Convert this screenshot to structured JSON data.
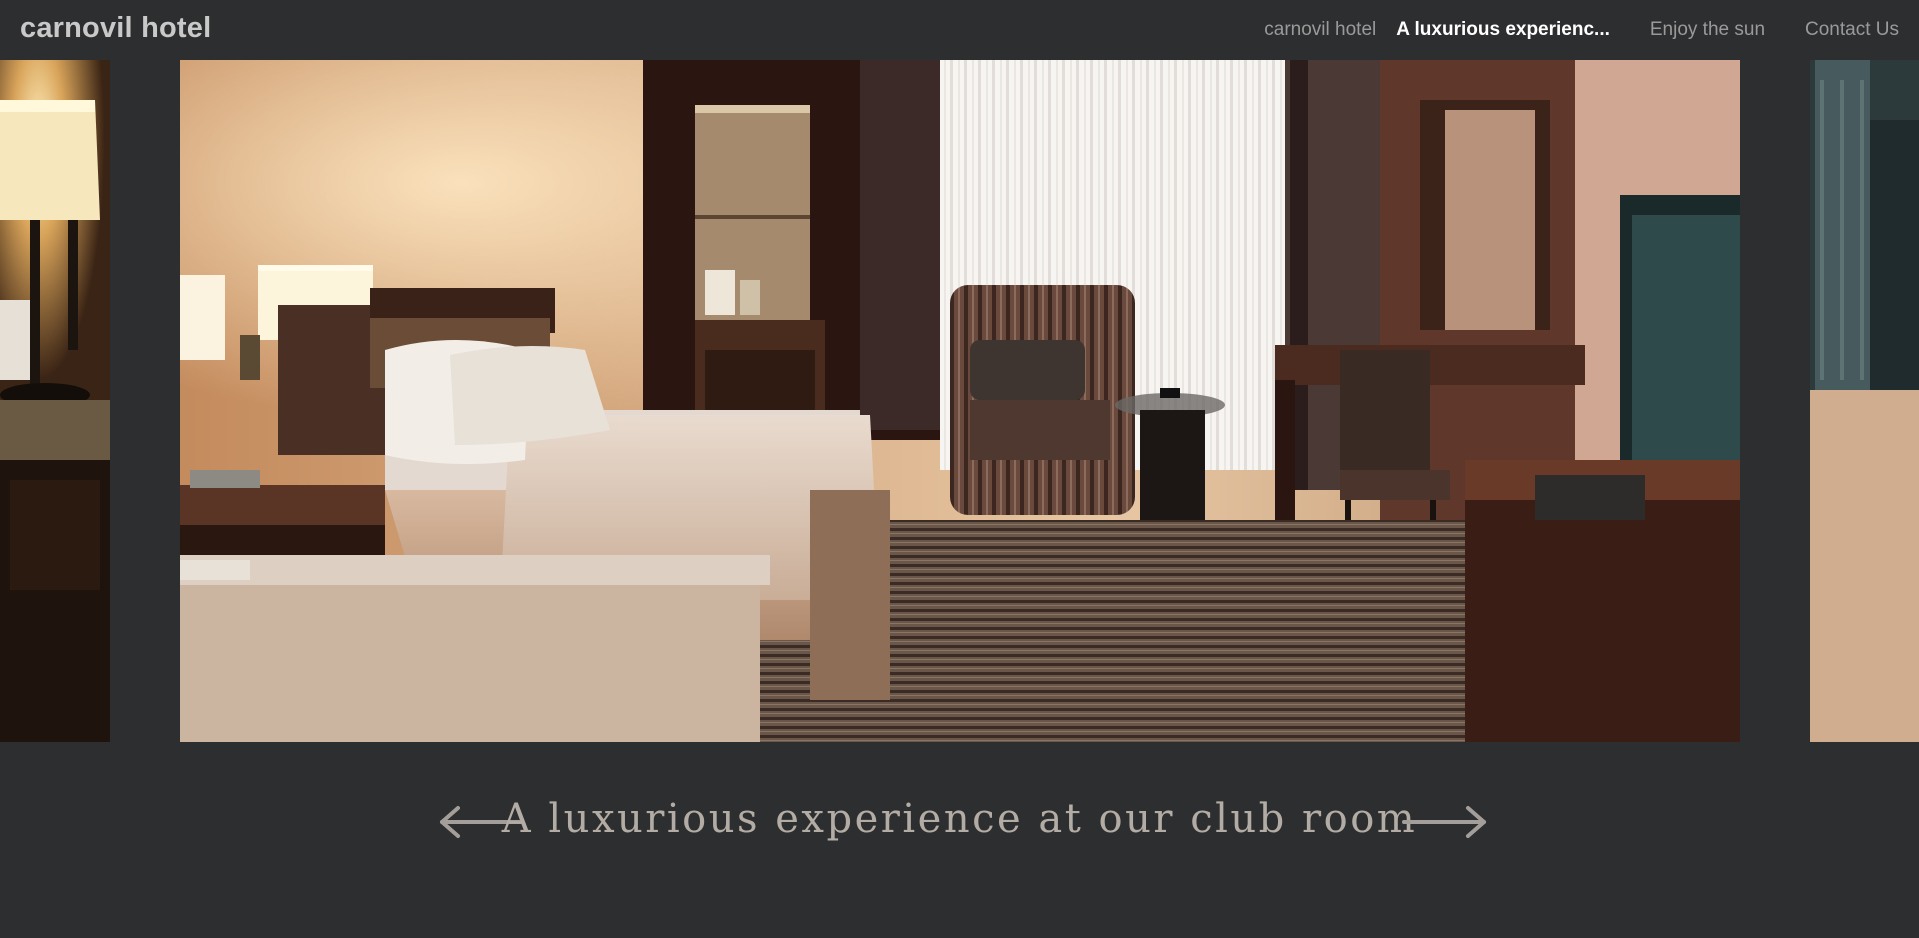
{
  "header": {
    "brand": "carnovil hotel",
    "nav": [
      {
        "label": "carnovil hotel"
      },
      {
        "label": "A luxurious experienc..."
      },
      {
        "label": "Enjoy the sun"
      },
      {
        "label": "Contact Us"
      }
    ]
  },
  "slider": {
    "caption": "A luxurious experience at our club room",
    "prev_icon": "arrow-left-icon",
    "next_icon": "arrow-right-icon"
  },
  "colors": {
    "background": "#2d2e30",
    "nav_text": "#9a9a9a",
    "nav_active": "#ffffff",
    "caption": "#b3aca5"
  }
}
